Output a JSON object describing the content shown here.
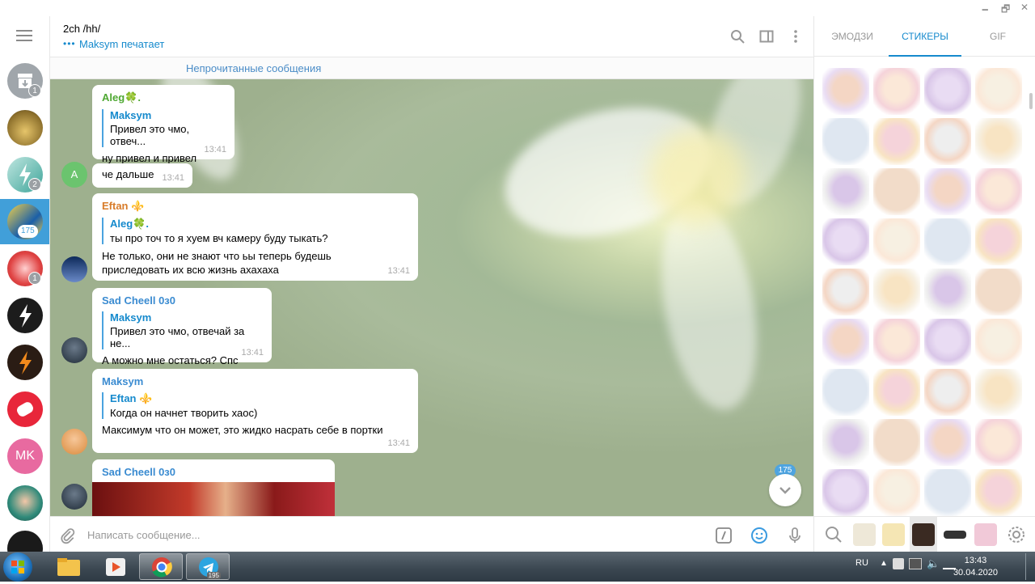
{
  "window": {
    "minimize": "🗕",
    "maximize": "🗗",
    "close": "✕"
  },
  "header": {
    "title": "2ch /hh/",
    "status": "Maksym печатает",
    "typing_dots": "•••"
  },
  "left_sidebar": {
    "chats": [
      {
        "name": "archive",
        "badge": "1"
      },
      {
        "name": "chat-2",
        "badge": ""
      },
      {
        "name": "chat-3",
        "badge": "2"
      },
      {
        "name": "chat-2ch-hh",
        "badge": "175",
        "active": true
      },
      {
        "name": "chat-5",
        "badge": "1"
      },
      {
        "name": "chat-6",
        "badge": ""
      },
      {
        "name": "chat-7",
        "badge": ""
      },
      {
        "name": "chat-8",
        "badge": ""
      },
      {
        "name": "chat-mk",
        "initials": "MK",
        "badge": ""
      },
      {
        "name": "chat-10",
        "badge": ""
      },
      {
        "name": "chat-11",
        "badge": ""
      }
    ]
  },
  "unread_bar": "Непрочитанные сообщения",
  "messages": [
    {
      "sender": "Aleg🍀.",
      "sender_color": "#4fa833",
      "reply_name": "Maksym",
      "reply_text": "Привел это чмо, отвеч...",
      "text": "ну привел и привел",
      "time": "13:41"
    },
    {
      "sender": "",
      "text": "че дальше",
      "time": "13:41",
      "avatar_letter": "A"
    },
    {
      "sender": "Eftan ⚜️",
      "sender_color": "#d87c2a",
      "reply_name": "Aleg🍀.",
      "reply_text": "ты про точ то я хуем вч камеру буду тыкать?",
      "text": "Не только, они не знают что ьы теперь будешь приследовать их всю жизнь ахахаха",
      "time": "13:41"
    },
    {
      "sender": "Sad Cheell 0з0",
      "sender_color": "#3a8bd1",
      "reply_name": "Maksym",
      "reply_text": "Привел это чмо, отвечай за не...",
      "text": "А можно мне остаться? Спс",
      "time": "13:41"
    },
    {
      "sender": "Maksym",
      "sender_color": "#3a8bd1",
      "reply_name": "Eftan ⚜️",
      "reply_text": "Когда он начнет творить хаос)",
      "text": "Максимум что он может, это жидко насрать себе в портки",
      "time": "13:41"
    },
    {
      "sender": "Sad Cheell 0з0",
      "sender_color": "#3a8bd1",
      "text": "",
      "time": ""
    }
  ],
  "scroll_badge": "175",
  "composer": {
    "placeholder": "Написать сообщение..."
  },
  "sticker_panel": {
    "tabs": [
      "ЭМОДЗИ",
      "СТИКЕРЫ",
      "GIF"
    ],
    "active_tab": "СТИКЕРЫ"
  },
  "taskbar": {
    "lang": "RU",
    "time": "13:43",
    "date": "30.04.2020",
    "telegram_badge": "195"
  }
}
